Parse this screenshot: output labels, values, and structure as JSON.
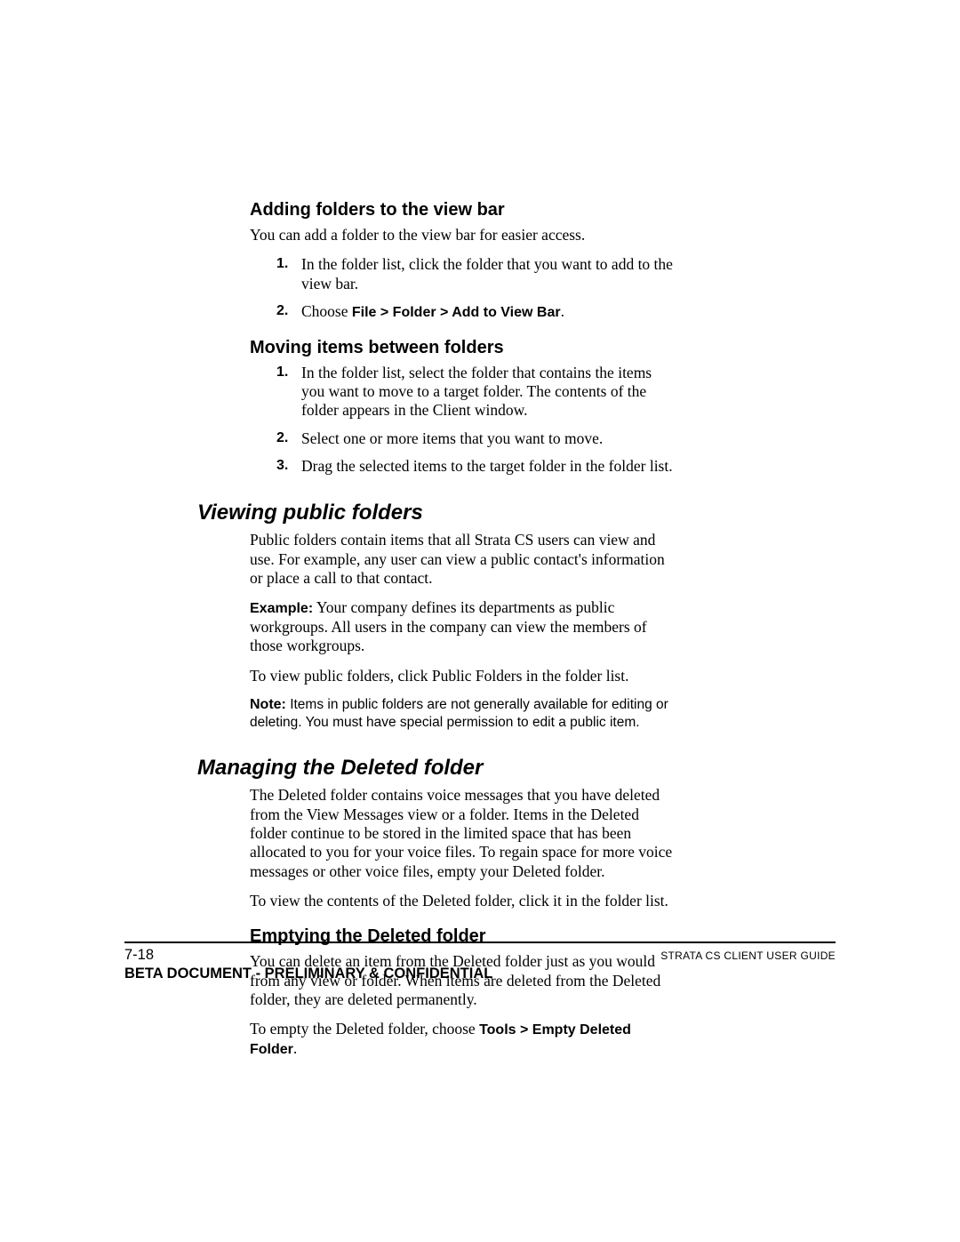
{
  "sections": {
    "adding": {
      "heading": "Adding folders to the view bar",
      "intro": "You can add a folder to the view bar for easier access.",
      "steps": [
        {
          "num": "1.",
          "text": "In the folder list, click the folder that you want to add to the view bar."
        },
        {
          "num": "2.",
          "prefix": "Choose ",
          "bold": "File > Folder > Add to View Bar",
          "suffix": "."
        }
      ]
    },
    "moving": {
      "heading": "Moving items between folders",
      "steps": [
        {
          "num": "1.",
          "text": "In the folder list, select the folder that contains the items you want to move to a target folder. The contents of the folder appears in the Client window."
        },
        {
          "num": "2.",
          "text": "Select one or more items that you want to move."
        },
        {
          "num": "3.",
          "text": "Drag the selected items to the target folder in the folder list."
        }
      ]
    },
    "viewing": {
      "heading": "Viewing public folders",
      "p1": "Public folders contain items that all Strata CS users can view and use. For example, any user can view a public contact's information or place a call to that contact.",
      "example_label": "Example:",
      "example_text": " Your company defines its departments as public workgroups. All users in the company can view the members of those workgroups.",
      "p3": "To view public folders, click Public Folders in the folder list.",
      "note_label": "Note:",
      "note_text": "  Items in public folders are not generally available for editing or deleting. You must have special permission to edit a public item."
    },
    "managing": {
      "heading": "Managing the Deleted folder",
      "p1": "The Deleted folder contains voice messages that you have deleted from the View Messages view or a folder. Items in the Deleted folder continue to be stored in the limited space that has been allocated to you for your voice files. To regain space for more voice messages or other voice files, empty your Deleted folder.",
      "p2": "To view the contents of the Deleted folder, click it in the folder list."
    },
    "emptying": {
      "heading": "Emptying the Deleted folder",
      "p1": "You can delete an item from the Deleted folder just as you would from any view or folder. When items are deleted from the Deleted folder, they are deleted permanently.",
      "p2_prefix": "To empty the Deleted folder, choose ",
      "p2_bold": "Tools > Empty Deleted Folder",
      "p2_suffix": "."
    }
  },
  "footer": {
    "page": "7-18",
    "right": "STRATA CS CLIENT USER GUIDE",
    "confidential": "BETA DOCUMENT - PRELIMINARY & CONFIDENTIAL"
  }
}
